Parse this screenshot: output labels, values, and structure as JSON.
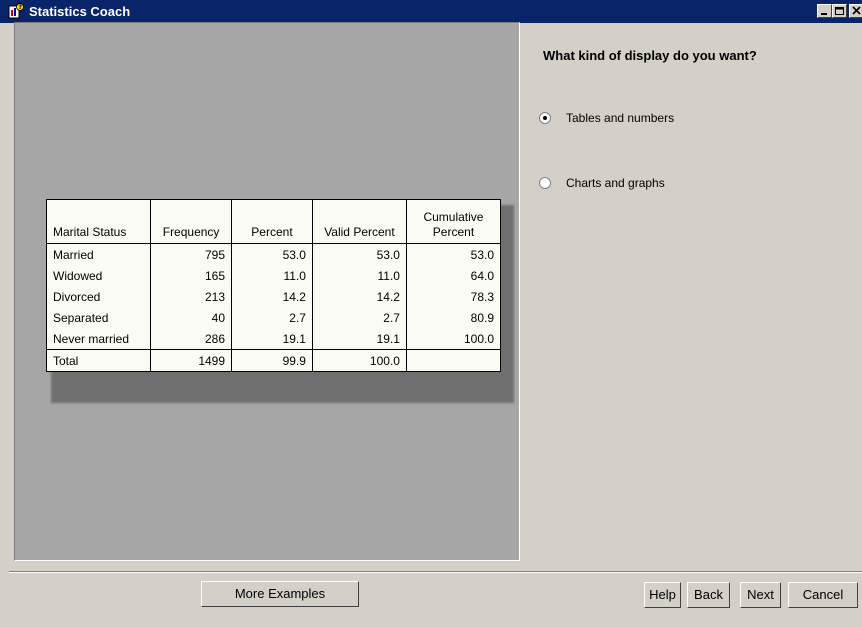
{
  "window": {
    "title": "Statistics Coach"
  },
  "question": {
    "text": "What kind of display do you want?",
    "options": [
      {
        "label": "Tables and numbers",
        "selected": true
      },
      {
        "label": "Charts and graphs",
        "selected": false
      }
    ]
  },
  "example_table": {
    "headers": [
      "Marital Status",
      "Frequency",
      "Percent",
      "Valid Percent",
      "Cumulative Percent"
    ],
    "rows": [
      [
        "Married",
        "795",
        "53.0",
        "53.0",
        "53.0"
      ],
      [
        "Widowed",
        "165",
        "11.0",
        "11.0",
        "64.0"
      ],
      [
        "Divorced",
        "213",
        "14.2",
        "14.2",
        "78.3"
      ],
      [
        "Separated",
        "40",
        "2.7",
        "2.7",
        "80.9"
      ],
      [
        "Never married",
        "286",
        "19.1",
        "19.1",
        "100.0"
      ],
      [
        "Total",
        "1499",
        "99.9",
        "100.0",
        ""
      ]
    ]
  },
  "buttons": {
    "more_examples": "More Examples",
    "help": "Help",
    "back": "Back",
    "next": "Next",
    "cancel": "Cancel"
  }
}
